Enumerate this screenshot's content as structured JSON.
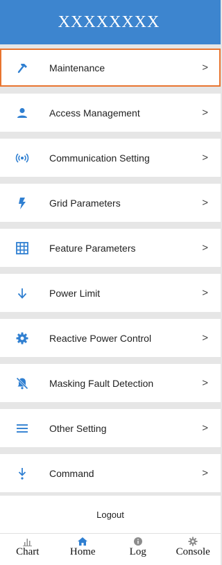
{
  "header": {
    "title": "XXXXXXXX"
  },
  "menu": [
    {
      "label": "Maintenance",
      "icon": "hammer-icon",
      "chevron": ">"
    },
    {
      "label": "Access Management",
      "icon": "person-icon",
      "chevron": ">"
    },
    {
      "label": "Communication Setting",
      "icon": "wireless-signal-icon",
      "chevron": ">"
    },
    {
      "label": "Grid Parameters",
      "icon": "lightning-bolt-icon",
      "chevron": ">"
    },
    {
      "label": "Feature Parameters",
      "icon": "grid-table-icon",
      "chevron": ">"
    },
    {
      "label": "Power Limit",
      "icon": "arrow-down-icon",
      "chevron": ">"
    },
    {
      "label": "Reactive Power Control",
      "icon": "gear-icon",
      "chevron": ">"
    },
    {
      "label": "Masking Fault Detection",
      "icon": "bell-off-icon",
      "chevron": ">"
    },
    {
      "label": "Other Setting",
      "icon": "menu-lines-icon",
      "chevron": ">"
    },
    {
      "label": "Command",
      "icon": "arrow-down-to-point-icon",
      "chevron": ">"
    }
  ],
  "logout": {
    "label": "Logout"
  },
  "bottom_nav": [
    {
      "label": "Chart",
      "icon": "bar-chart-icon"
    },
    {
      "label": "Home",
      "icon": "home-icon"
    },
    {
      "label": "Log",
      "icon": "info-icon"
    },
    {
      "label": "Console",
      "icon": "gear-icon"
    }
  ],
  "colors": {
    "header_bg": "#3d85cf",
    "icon_blue": "#2f7fd1",
    "selected_border": "#e8742f",
    "page_bg": "#e6e6e6",
    "muted_icon": "#8c8c8c"
  }
}
